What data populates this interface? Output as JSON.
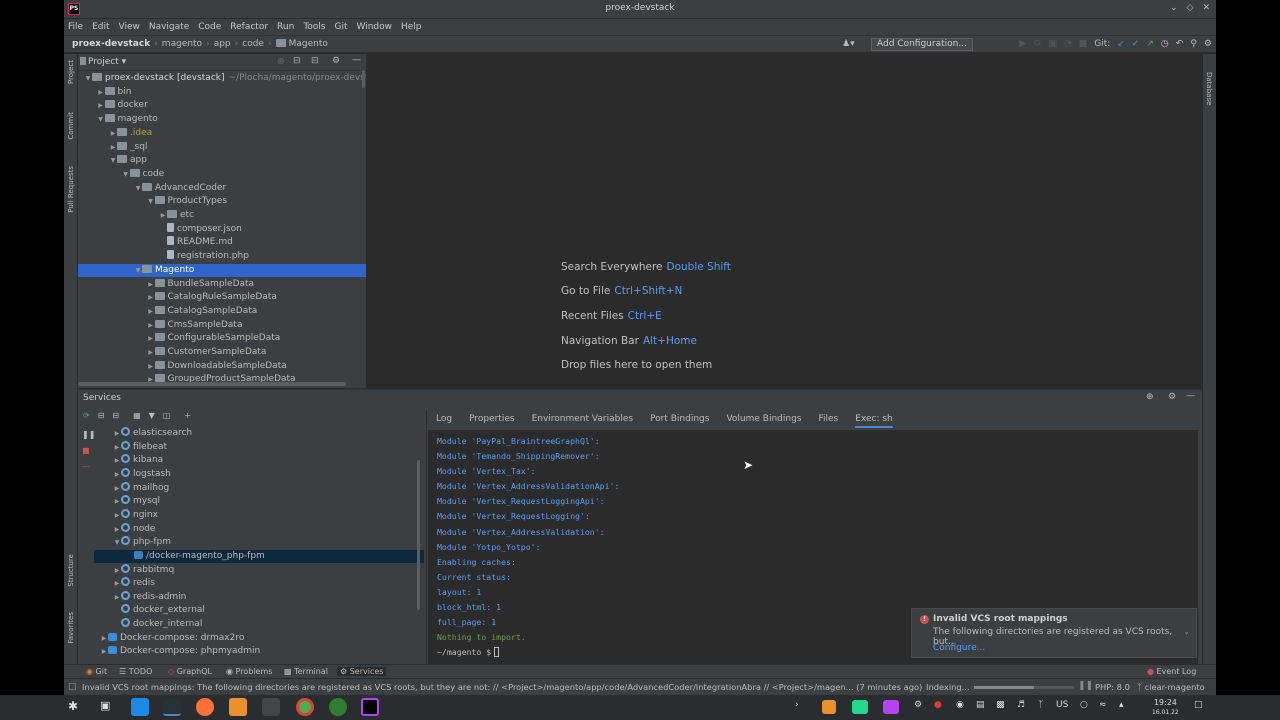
{
  "window": {
    "title": "proex-devstack",
    "app_icon": "PS",
    "controls": [
      "chevron-down-icon",
      "diamond-icon",
      "close-icon"
    ]
  },
  "menu": [
    "File",
    "Edit",
    "View",
    "Navigate",
    "Code",
    "Refactor",
    "Run",
    "Tools",
    "Git",
    "Window",
    "Help"
  ],
  "breadcrumb": [
    "proex-devstack",
    "magento",
    "app",
    "code",
    "Magento"
  ],
  "toolbar": {
    "run_config": "Add Configuration...",
    "git_label": "Git:"
  },
  "left_stripe": [
    "Project",
    "Commit",
    "Pull Requests",
    "Structure",
    "Favorites"
  ],
  "right_stripe": [
    "Database"
  ],
  "project_panel": {
    "title": "Project",
    "tree": [
      {
        "label": "proex-devstack [devstack]",
        "suffix": "~/Plocha/magento/proex-devstack",
        "depth": 0,
        "arrow": "down",
        "kind": "folder",
        "bold": true
      },
      {
        "label": "bin",
        "depth": 1,
        "arrow": "right",
        "kind": "folder"
      },
      {
        "label": "docker",
        "depth": 1,
        "arrow": "right",
        "kind": "folder"
      },
      {
        "label": "magento",
        "depth": 1,
        "arrow": "down",
        "kind": "folder"
      },
      {
        "label": ".idea",
        "depth": 2,
        "arrow": "right",
        "kind": "folder",
        "dim": true
      },
      {
        "label": "_sql",
        "depth": 2,
        "arrow": "right",
        "kind": "folder"
      },
      {
        "label": "app",
        "depth": 2,
        "arrow": "down",
        "kind": "folder"
      },
      {
        "label": "code",
        "depth": 3,
        "arrow": "down",
        "kind": "folder"
      },
      {
        "label": "AdvancedCoder",
        "depth": 4,
        "arrow": "down",
        "kind": "folder"
      },
      {
        "label": "ProductTypes",
        "depth": 5,
        "arrow": "down",
        "kind": "folder"
      },
      {
        "label": "etc",
        "depth": 6,
        "arrow": "right",
        "kind": "folder"
      },
      {
        "label": "composer.json",
        "depth": 6,
        "arrow": "",
        "kind": "file"
      },
      {
        "label": "README.md",
        "depth": 6,
        "arrow": "",
        "kind": "file"
      },
      {
        "label": "registration.php",
        "depth": 6,
        "arrow": "",
        "kind": "file"
      },
      {
        "label": "Magento",
        "depth": 4,
        "arrow": "down",
        "kind": "folder",
        "selected": true
      },
      {
        "label": "BundleSampleData",
        "depth": 5,
        "arrow": "right",
        "kind": "folder"
      },
      {
        "label": "CatalogRuleSampleData",
        "depth": 5,
        "arrow": "right",
        "kind": "folder"
      },
      {
        "label": "CatalogSampleData",
        "depth": 5,
        "arrow": "right",
        "kind": "folder"
      },
      {
        "label": "CmsSampleData",
        "depth": 5,
        "arrow": "right",
        "kind": "folder"
      },
      {
        "label": "ConfigurableSampleData",
        "depth": 5,
        "arrow": "right",
        "kind": "folder"
      },
      {
        "label": "CustomerSampleData",
        "depth": 5,
        "arrow": "right",
        "kind": "folder"
      },
      {
        "label": "DownloadableSampleData",
        "depth": 5,
        "arrow": "right",
        "kind": "folder"
      },
      {
        "label": "GroupedProductSampleData",
        "depth": 5,
        "arrow": "right",
        "kind": "folder"
      }
    ]
  },
  "editor_hints": [
    {
      "text": "Search Everywhere",
      "key": "Double Shift"
    },
    {
      "text": "Go to File",
      "key": "Ctrl+Shift+N"
    },
    {
      "text": "Recent Files",
      "key": "Ctrl+E"
    },
    {
      "text": "Navigation Bar",
      "key": "Alt+Home"
    },
    {
      "text": "Drop files here to open them",
      "key": ""
    }
  ],
  "services": {
    "title": "Services",
    "tree": [
      {
        "label": "elasticsearch",
        "depth": 1,
        "arrow": "right",
        "kind": "gear"
      },
      {
        "label": "filebeat",
        "depth": 1,
        "arrow": "right",
        "kind": "gear"
      },
      {
        "label": "kibana",
        "depth": 1,
        "arrow": "right",
        "kind": "gear"
      },
      {
        "label": "logstash",
        "depth": 1,
        "arrow": "right",
        "kind": "gear"
      },
      {
        "label": "mailhog",
        "depth": 1,
        "arrow": "right",
        "kind": "gear"
      },
      {
        "label": "mysql",
        "depth": 1,
        "arrow": "right",
        "kind": "gear"
      },
      {
        "label": "nginx",
        "depth": 1,
        "arrow": "right",
        "kind": "gear"
      },
      {
        "label": "node",
        "depth": 1,
        "arrow": "right",
        "kind": "gear"
      },
      {
        "label": "php-fpm",
        "depth": 1,
        "arrow": "down",
        "kind": "gear"
      },
      {
        "label": "/docker-magento_php-fpm",
        "depth": 2,
        "arrow": "",
        "kind": "container",
        "selected": true
      },
      {
        "label": "rabbitmq",
        "depth": 1,
        "arrow": "right",
        "kind": "gear"
      },
      {
        "label": "redis",
        "depth": 1,
        "arrow": "right",
        "kind": "gear"
      },
      {
        "label": "redis-admin",
        "depth": 1,
        "arrow": "right",
        "kind": "gear"
      },
      {
        "label": "docker_external",
        "depth": 1,
        "arrow": "",
        "kind": "gear"
      },
      {
        "label": "docker_internal",
        "depth": 1,
        "arrow": "",
        "kind": "gear"
      },
      {
        "label": "Docker-compose: drmax2ro",
        "depth": 0,
        "arrow": "right",
        "kind": "whale"
      },
      {
        "label": "Docker-compose: phpmyadmin",
        "depth": 0,
        "arrow": "right",
        "kind": "whale"
      }
    ],
    "tabs": [
      "Log",
      "Properties",
      "Environment Variables",
      "Port Bindings",
      "Volume Bindings",
      "Files",
      "Exec: sh"
    ],
    "active_tab": "Exec: sh",
    "console": [
      {
        "text": "Module 'PayPal_BraintreeGraphQl':",
        "style": "blue"
      },
      {
        "text": "Module 'Temando_ShippingRemover':",
        "style": "blue"
      },
      {
        "text": "Module 'Vertex_Tax':",
        "style": "blue"
      },
      {
        "text": "Module 'Vertex_AddressValidationApi':",
        "style": "blue"
      },
      {
        "text": "Module 'Vertex_RequestLoggingApi':",
        "style": "blue"
      },
      {
        "text": "Module 'Vertex_RequestLogging':",
        "style": "blue"
      },
      {
        "text": "Module 'Vertex_AddressValidation':",
        "style": "blue"
      },
      {
        "text": "Module 'Yotpo_Yotpo':",
        "style": "blue"
      },
      {
        "text": "Enabling caches:",
        "style": "blue"
      },
      {
        "text": "Current status:",
        "style": "blue"
      },
      {
        "text": "layout: 1",
        "style": "blue"
      },
      {
        "text": "block_html: 1",
        "style": "blue"
      },
      {
        "text": "full_page: 1",
        "style": "blue"
      },
      {
        "text": "Nothing to import.",
        "style": "green"
      },
      {
        "text": "~/magento $",
        "style": "prompt"
      }
    ]
  },
  "notification": {
    "title": "Invalid VCS root mappings",
    "body": "The following directories are registered as VCS roots, but...",
    "action": "Configure..."
  },
  "bottom_tools": [
    "Git",
    "TODO",
    "GraphQL",
    "Problems",
    "Terminal",
    "Services",
    "Event Log"
  ],
  "status": {
    "message": "Invalid VCS root mappings: The following directories are registered as VCS roots, but they are not: // <Project>/magento/app/code/AdvancedCoder/IntegrationAbra // <Project>/magen... (7 minutes ago)",
    "indexing": "Indexing...",
    "php": "PHP: 8.0",
    "branch": "clear-magento",
    "indexing_progress": 0.6
  },
  "taskbar": {
    "lang": "US",
    "time": "19:24",
    "date": "16.01.22"
  }
}
